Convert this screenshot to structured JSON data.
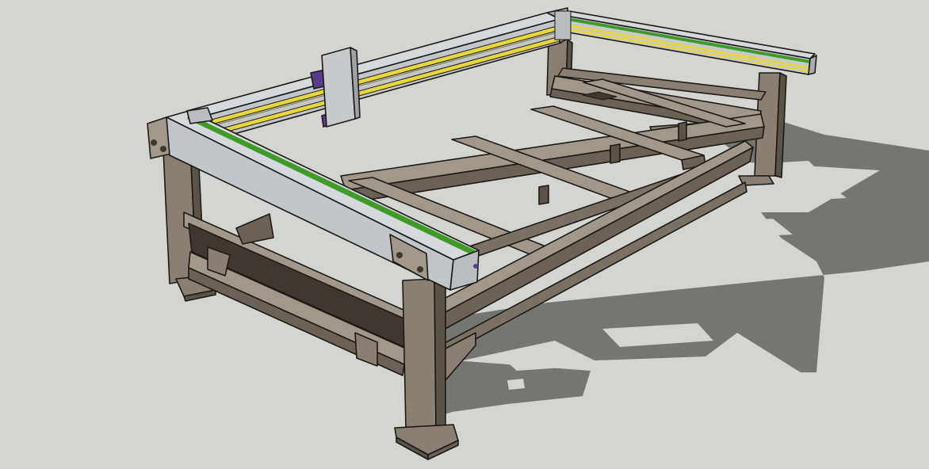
{
  "scene": {
    "background": "#d4d4d0",
    "model": "cnc-gantry-table-frame",
    "colors": {
      "steel_frame": "#8a7f72",
      "steel_frame_light": "#a1978a",
      "steel_frame_dark": "#5b5248",
      "steel_frame_shadow": "#3f3831",
      "aluminum_rail": "#d6d9dc",
      "aluminum_rail_side": "#b9bdc2",
      "linear_guide_yellow": "#e6d640",
      "linear_guide_green": "#3f9a28",
      "carriage_plate": "#c6cacd",
      "motor_purple": "#5a3c8c",
      "ground_shadow": "#757571"
    }
  }
}
